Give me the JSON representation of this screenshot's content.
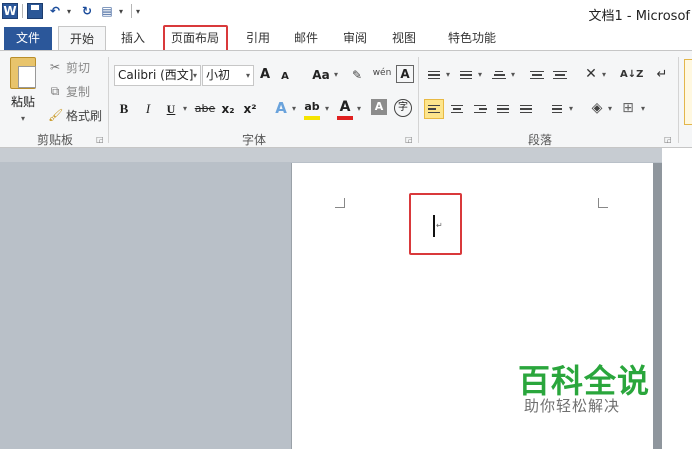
{
  "titlebar": {
    "window_title": "文档1 - Microsof"
  },
  "tabs": {
    "file": "文件",
    "home": "开始",
    "insert": "插入",
    "page_layout": "页面布局",
    "references": "引用",
    "mailings": "邮件",
    "review": "审阅",
    "view": "视图",
    "special": "特色功能"
  },
  "clipboard": {
    "paste": "粘贴",
    "cut": "剪切",
    "copy": "复制",
    "format_painter": "格式刷",
    "group_label": "剪贴板"
  },
  "font": {
    "font_name": "Calibri (西文]",
    "font_size": "小初",
    "grow": "A",
    "shrink": "A",
    "change_case": "Aa",
    "pinyin": "wén",
    "bold": "B",
    "italic": "I",
    "underline": "U",
    "strikethrough": "abe",
    "subscript": "x₂",
    "superscript": "x²",
    "text_effects": "A",
    "highlight": "ab",
    "font_color": "A",
    "char_shading": "A",
    "char_border": "A",
    "enclose": "字",
    "group_label": "字体"
  },
  "paragraph": {
    "sort": "A↓Z",
    "group_label": "段落"
  },
  "watermark": {
    "title": "百科全说",
    "subtitle": "助你轻松解决"
  },
  "colors": {
    "accent": "#2b579a",
    "highlight_red": "#d9393b",
    "watermark_green": "#2aa63c"
  }
}
